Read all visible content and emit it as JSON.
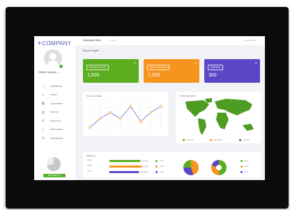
{
  "brand": {
    "name": "COMPANY",
    "accent": "#4a55b8"
  },
  "user": {
    "name": "Olivier Dupont",
    "status_color": "#53b12a"
  },
  "sidebar": {
    "items": [
      {
        "label": "DASHBOARD",
        "icon": "home-icon",
        "active": true
      },
      {
        "label": "PROFIL",
        "icon": "user-icon"
      },
      {
        "label": "CALENDRIER",
        "icon": "calendar-icon"
      },
      {
        "label": "GRAPHS",
        "icon": "chart-icon"
      },
      {
        "label": "BOÎTE MAIL",
        "icon": "mail-icon"
      },
      {
        "label": "MESSAGERIE",
        "icon": "chat-icon"
      },
      {
        "label": "PARAMÈTRES",
        "icon": "gear-icon"
      }
    ],
    "button_label": "DÉCONNEXION"
  },
  "topbar": {
    "title": "Dashboard Main",
    "search": "rech",
    "user": "Louis Dufour"
  },
  "breadcrumb": {
    "label": "Récent Projets"
  },
  "stats": [
    {
      "label": "PRODUCTION",
      "value": "1,500",
      "color": "#5cad1f"
    },
    {
      "label": "FACTURATION",
      "value": "7,500",
      "color": "#f7941d"
    },
    {
      "label": "PERTES",
      "value": "300",
      "color": "#5a47c8"
    }
  ],
  "line_chart": {
    "title": "Temps de travail"
  },
  "map": {
    "title": "TOUS LES PAYS",
    "legend": [
      "Amérique",
      "Europe/Asie",
      "Océanie"
    ],
    "colors": [
      "#5cad1f",
      "#f7941d",
      "#5a47c8"
    ]
  },
  "summary": {
    "title": "Tableau A",
    "bars": [
      {
        "label": "Lorem",
        "value": 0.78,
        "color": "#5cad1f",
        "pct": "78%"
      },
      {
        "label": "Lorem",
        "value": 0.82,
        "color": "#f7941d",
        "pct": "82%"
      },
      {
        "label": "Lorem",
        "value": 0.75,
        "color": "#5a47c8",
        "pct": "75%"
      }
    ],
    "legend": [
      "Lorem",
      "Lorem",
      "Lorem"
    ]
  },
  "chart_data": {
    "type": "line",
    "title": "Temps de travail",
    "xlabel": "",
    "ylabel": "",
    "x": [
      1,
      2,
      3,
      4,
      5,
      6,
      7,
      8
    ],
    "series": [
      {
        "values": [
          1,
          4,
          6,
          4,
          8,
          3,
          6,
          8
        ]
      }
    ],
    "ylim": [
      0,
      10
    ],
    "grid": true
  },
  "pies": [
    {
      "slices": [
        0.45,
        0.3,
        0.25
      ],
      "colors": [
        "#f7941d",
        "#5a47c8",
        "#5cad1f"
      ]
    },
    {
      "slices": [
        0.5,
        0.3,
        0.2
      ],
      "colors": [
        "#5cad1f",
        "#f7941d",
        "#5a47c8"
      ],
      "donut": true
    }
  ]
}
